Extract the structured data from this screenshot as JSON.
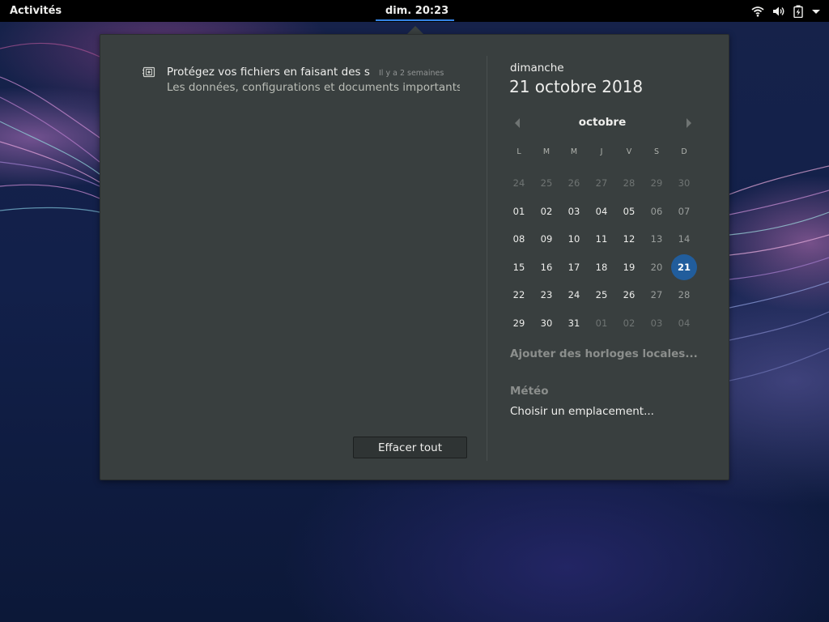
{
  "topbar": {
    "activities_label": "Activités",
    "clock_label": "dim. 20:23",
    "tray_icons": [
      "wifi-icon",
      "volume-icon",
      "battery-icon",
      "system-menu-arrow-icon"
    ]
  },
  "notification": {
    "icon": "backup-icon",
    "title": "Protégez vos fichiers en faisant des s...",
    "time": "Il y a 2 semaines",
    "body": "Les données, configurations et documents importants ..."
  },
  "clear_button_label": "Effacer tout",
  "calendar": {
    "weekday": "dimanche",
    "full_date": "21 octobre 2018",
    "month": "octobre",
    "day_headers": [
      "L",
      "M",
      "M",
      "J",
      "V",
      "S",
      "D"
    ],
    "weeks": [
      [
        "24",
        "25",
        "26",
        "27",
        "28",
        "29",
        "30"
      ],
      [
        "01",
        "02",
        "03",
        "04",
        "05",
        "06",
        "07"
      ],
      [
        "08",
        "09",
        "10",
        "11",
        "12",
        "13",
        "14"
      ],
      [
        "15",
        "16",
        "17",
        "18",
        "19",
        "20",
        "21"
      ],
      [
        "22",
        "23",
        "24",
        "25",
        "26",
        "27",
        "28"
      ],
      [
        "29",
        "30",
        "31",
        "01",
        "02",
        "03",
        "04"
      ]
    ],
    "today": "21",
    "today_color": "#215d9c"
  },
  "world_clocks_label": "Ajouter des horloges locales...",
  "weather": {
    "title": "Météo",
    "location_prompt": "Choisir un emplacement..."
  },
  "colors": {
    "accent": "#3584e4",
    "popover_bg": "#393f3f",
    "topbar_bg": "#000000"
  }
}
